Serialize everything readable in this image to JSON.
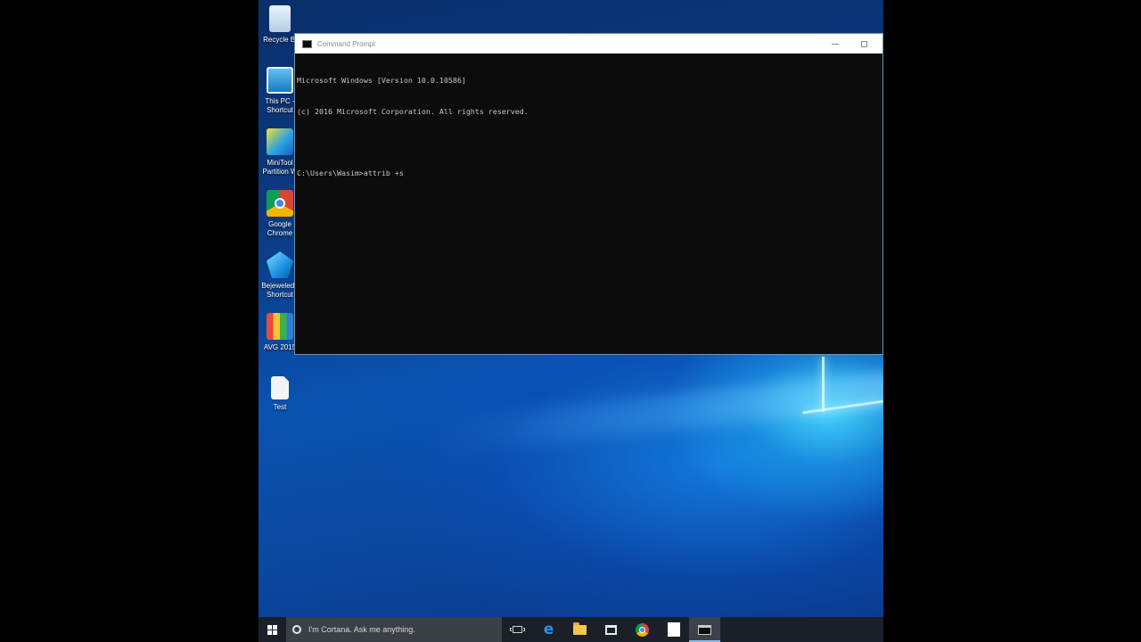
{
  "desktop": {
    "icons": [
      {
        "label": "Recycle Bi",
        "icon": "recycle-bin-icon"
      },
      {
        "label": "This PC - Shortcut",
        "icon": "this-pc-icon"
      },
      {
        "label": "MiniTool Partition W",
        "icon": "minitool-icon"
      },
      {
        "label": "Google Chrome",
        "icon": "chrome-icon"
      },
      {
        "label": "Bejeweled3 Shortcut",
        "icon": "bejeweled-icon"
      },
      {
        "label": "AVG 2015",
        "icon": "avg-icon"
      },
      {
        "label": "Test",
        "icon": "text-file-icon"
      }
    ]
  },
  "cmd_window": {
    "title": "Command Prompt",
    "lines": [
      "Microsoft Windows [Version 10.0.10586]",
      "(c) 2016 Microsoft Corporation. All rights reserved.",
      "",
      "C:\\Users\\Wasim>attrib +s"
    ]
  },
  "taskbar": {
    "cortana_placeholder": "I'm Cortana. Ask me anything.",
    "items": [
      {
        "name": "task-view-icon"
      },
      {
        "name": "edge-icon"
      },
      {
        "name": "file-explorer-icon"
      },
      {
        "name": "store-icon"
      },
      {
        "name": "chrome-icon"
      },
      {
        "name": "blank-document-icon"
      },
      {
        "name": "command-prompt-icon",
        "active": true
      }
    ]
  }
}
